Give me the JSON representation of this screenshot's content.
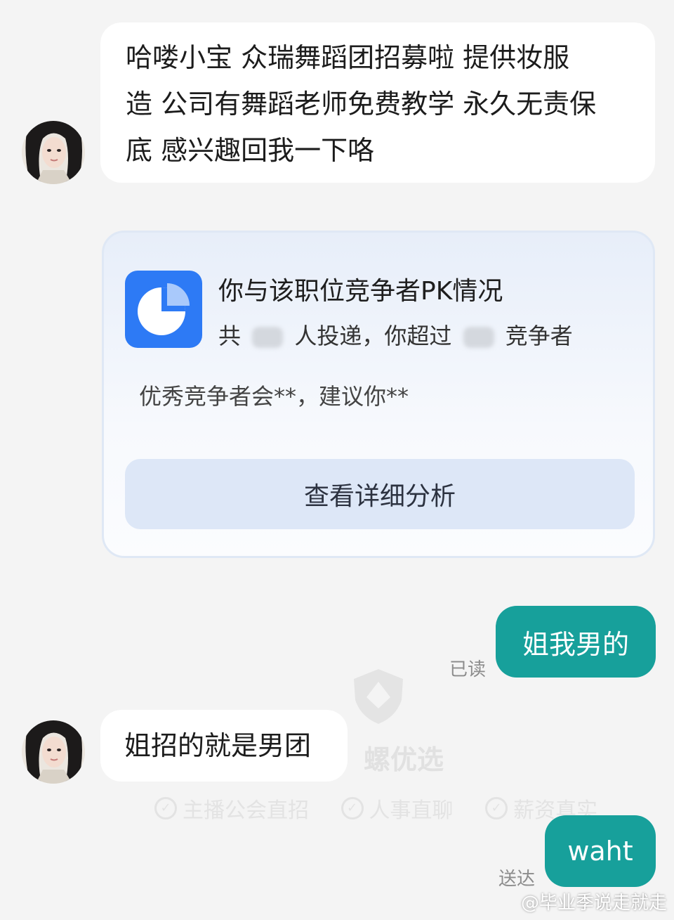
{
  "messages": {
    "m1": {
      "lines": [
        "哈喽小宝  众瑞舞蹈团招募啦  提供妆服",
        "造 公司有舞蹈老师免费教学 永久无责保",
        "底 感兴趣回我一下咯"
      ]
    },
    "card": {
      "title": "你与该职位竞争者PK情况",
      "sub_prefix": "共",
      "sub_count": "97",
      "sub_mid": "人投递，你超过",
      "sub_pct": "97",
      "sub_suffix": "竞争者",
      "advice": "优秀竞争者会**，建议你**",
      "button": "查看详细分析"
    },
    "m2": {
      "text": "姐我男的",
      "status": "已读"
    },
    "m3": {
      "text": "姐招的就是男团"
    },
    "m4": {
      "text": "waht",
      "status": "送达"
    }
  },
  "watermark": {
    "brand": "螺优选",
    "tags": [
      "主播公会直招",
      "人事直聊",
      "薪资真实"
    ]
  },
  "credit": "@毕业季说走就走",
  "colors": {
    "self_bubble": "#17a09b",
    "card_icon": "#2d7af5",
    "card_button": "#dde7f7"
  }
}
